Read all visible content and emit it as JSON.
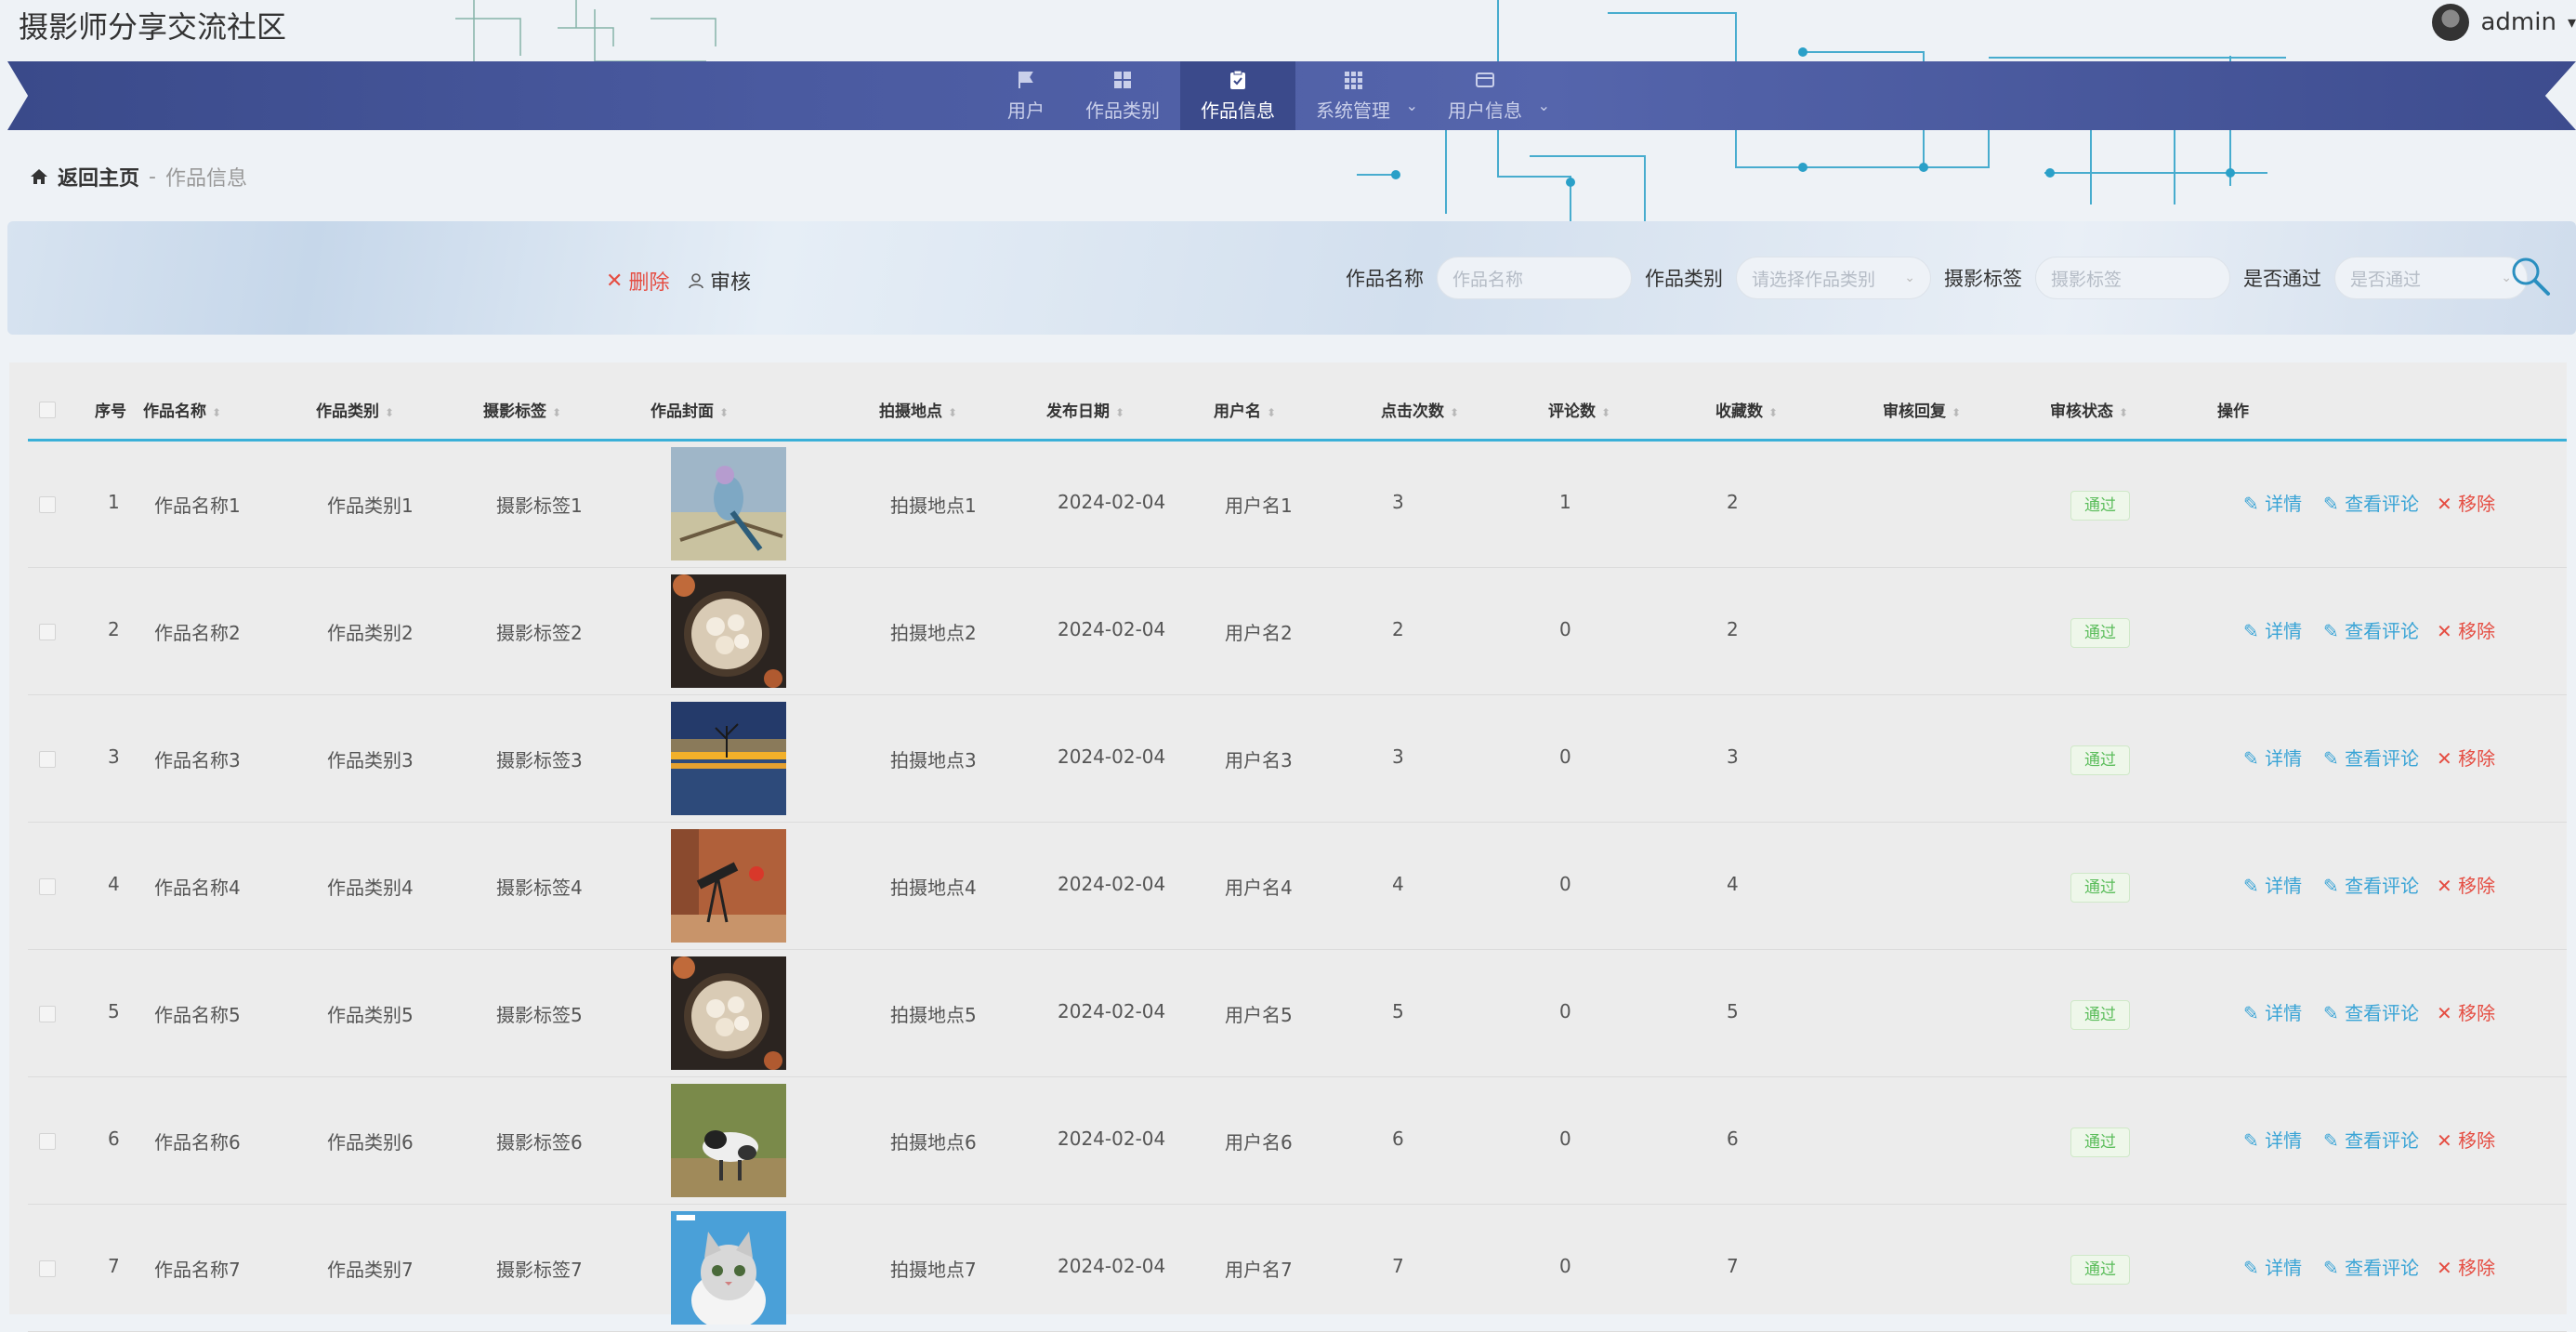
{
  "app": {
    "title": "摄影师分享交流社区",
    "user": "admin"
  },
  "nav": {
    "items": [
      {
        "label": "用户",
        "icon": "flag-icon"
      },
      {
        "label": "作品类别",
        "icon": "grid-icon"
      },
      {
        "label": "作品信息",
        "icon": "clipboard-icon"
      },
      {
        "label": "系统管理",
        "icon": "apps-icon"
      },
      {
        "label": "用户信息",
        "icon": "card-icon"
      }
    ],
    "active": "作品信息"
  },
  "breadcrumb": {
    "home": "返回主页",
    "sep": "-",
    "current": "作品信息"
  },
  "toolbar": {
    "delete_label": "删除",
    "audit_label": "审核"
  },
  "filters": {
    "name_label": "作品名称",
    "name_placeholder": "作品名称",
    "category_label": "作品类别",
    "category_placeholder": "请选择作品类别",
    "tag_label": "摄影标签",
    "tag_placeholder": "摄影标签",
    "pass_label": "是否通过",
    "pass_placeholder": "是否通过"
  },
  "table": {
    "columns": [
      "序号",
      "作品名称",
      "作品类别",
      "摄影标签",
      "作品封面",
      "拍摄地点",
      "发布日期",
      "用户名",
      "点击次数",
      "评论数",
      "收藏数",
      "审核回复",
      "审核状态",
      "操作"
    ],
    "actions": {
      "detail": "详情",
      "comments": "查看评论",
      "remove": "移除"
    },
    "rows": [
      {
        "idx": "1",
        "name": "作品名称1",
        "category": "作品类别1",
        "tag": "摄影标签1",
        "cover": "bird",
        "location": "拍摄地点1",
        "date": "2024-02-04",
        "user": "用户名1",
        "clicks": "3",
        "comments": "1",
        "favorites": "2",
        "reply": "",
        "status": "通过"
      },
      {
        "idx": "2",
        "name": "作品名称2",
        "category": "作品类别2",
        "tag": "摄影标签2",
        "cover": "food",
        "location": "拍摄地点2",
        "date": "2024-02-04",
        "user": "用户名2",
        "clicks": "2",
        "comments": "0",
        "favorites": "2",
        "reply": "",
        "status": "通过"
      },
      {
        "idx": "3",
        "name": "作品名称3",
        "category": "作品类别3",
        "tag": "摄影标签3",
        "cover": "sunset",
        "location": "拍摄地点3",
        "date": "2024-02-04",
        "user": "用户名3",
        "clicks": "3",
        "comments": "0",
        "favorites": "3",
        "reply": "",
        "status": "通过"
      },
      {
        "idx": "4",
        "name": "作品名称4",
        "category": "作品类别4",
        "tag": "摄影标签4",
        "cover": "telescope",
        "location": "拍摄地点4",
        "date": "2024-02-04",
        "user": "用户名4",
        "clicks": "4",
        "comments": "0",
        "favorites": "4",
        "reply": "",
        "status": "通过"
      },
      {
        "idx": "5",
        "name": "作品名称5",
        "category": "作品类别5",
        "tag": "摄影标签5",
        "cover": "food",
        "location": "拍摄地点5",
        "date": "2024-02-04",
        "user": "用户名5",
        "clicks": "5",
        "comments": "0",
        "favorites": "5",
        "reply": "",
        "status": "通过"
      },
      {
        "idx": "6",
        "name": "作品名称6",
        "category": "作品类别6",
        "tag": "摄影标签6",
        "cover": "animal",
        "location": "拍摄地点6",
        "date": "2024-02-04",
        "user": "用户名6",
        "clicks": "6",
        "comments": "0",
        "favorites": "6",
        "reply": "",
        "status": "通过"
      },
      {
        "idx": "7",
        "name": "作品名称7",
        "category": "作品类别7",
        "tag": "摄影标签7",
        "cover": "cat",
        "location": "拍摄地点7",
        "date": "2024-02-04",
        "user": "用户名7",
        "clicks": "7",
        "comments": "0",
        "favorites": "7",
        "reply": "",
        "status": "通过"
      }
    ]
  },
  "colors": {
    "nav": "#4a5aa0",
    "accent": "#3ab0d8",
    "danger": "#e54d42",
    "success": "#5bbd5b"
  }
}
